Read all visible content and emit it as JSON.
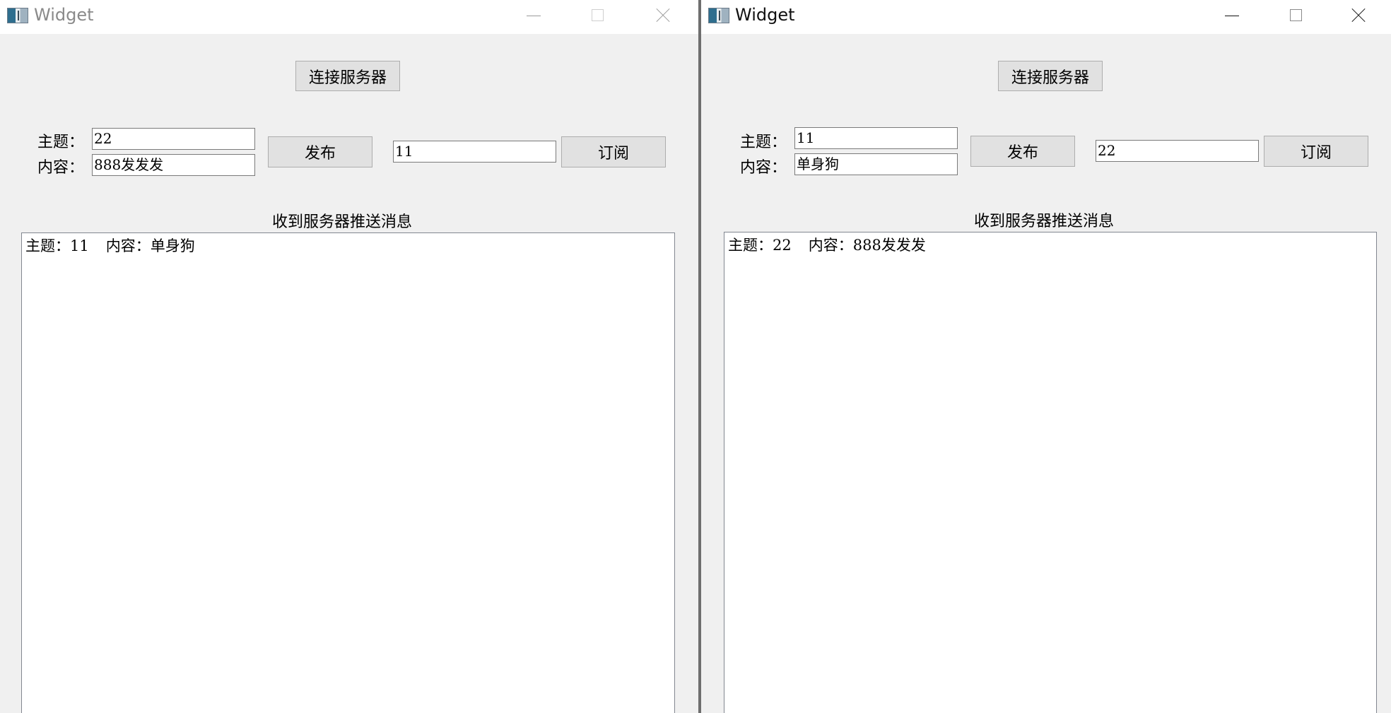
{
  "windows": [
    {
      "title": "Widget",
      "connect_button": "连接服务器",
      "topic_label": "主题：",
      "content_label": "内容：",
      "topic_value": "22",
      "content_value": "888发发发",
      "publish_button": "发布",
      "subscribe_topic_value": "11",
      "subscribe_button": "订阅",
      "messages_heading": "收到服务器推送消息",
      "messages": [
        {
          "topic_label": "主题：",
          "topic": "11",
          "content_label": "内容：",
          "content": "单身狗"
        }
      ]
    },
    {
      "title": "Widget",
      "connect_button": "连接服务器",
      "topic_label": "主题：",
      "content_label": "内容：",
      "topic_value": "11",
      "content_value": "单身狗",
      "publish_button": "发布",
      "subscribe_topic_value": "22",
      "subscribe_button": "订阅",
      "messages_heading": "收到服务器推送消息",
      "messages": [
        {
          "topic_label": "主题：",
          "topic": "22",
          "content_label": "内容：",
          "content": "888发发发"
        }
      ]
    }
  ],
  "icons": {
    "app": "widget-app-icon",
    "minimize": "minimize-icon",
    "maximize": "maximize-icon",
    "close": "close-icon"
  }
}
